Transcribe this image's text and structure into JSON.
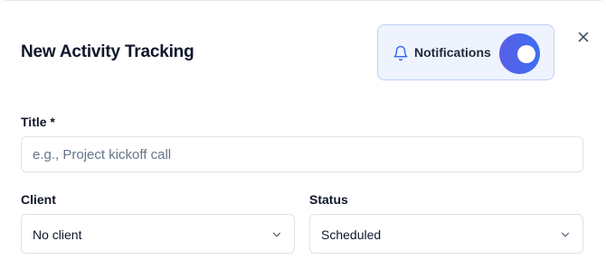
{
  "dialog": {
    "title": "New Activity Tracking"
  },
  "notifications": {
    "label": "Notifications",
    "enabled": true,
    "icon": "bell-icon",
    "accent_color": "#4f63ec"
  },
  "close": {
    "icon": "close-icon"
  },
  "form": {
    "title_field": {
      "label": "Title *",
      "value": "",
      "placeholder": "e.g., Project kickoff call"
    },
    "client_field": {
      "label": "Client",
      "selected": "No client",
      "icon": "chevron-down-icon"
    },
    "status_field": {
      "label": "Status",
      "selected": "Scheduled",
      "icon": "chevron-down-icon"
    }
  }
}
